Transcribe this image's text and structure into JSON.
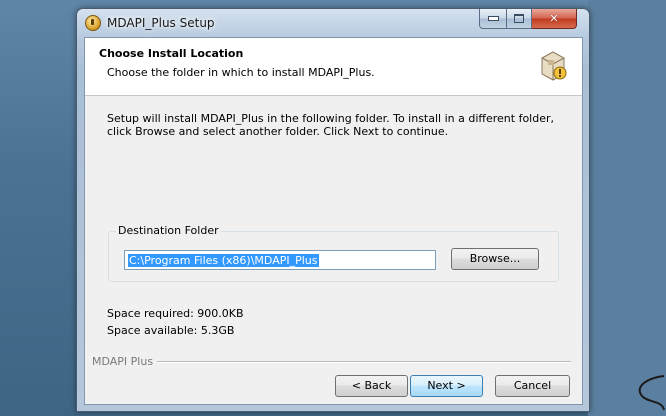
{
  "window": {
    "title": "MDAPI_Plus Setup"
  },
  "header": {
    "title": "Choose Install Location",
    "subtitle": "Choose the folder in which to install MDAPI_Plus."
  },
  "intro_text": "Setup will install MDAPI_Plus in the following folder. To install in a different folder, click Browse and select another folder. Click Next to continue.",
  "destination": {
    "group_label": "Destination Folder",
    "path_value": "C:\\Program Files (x86)\\MDAPI_Plus",
    "browse_label": "Browse..."
  },
  "space": {
    "required": "Space required: 900.0KB",
    "available": "Space available: 5.3GB"
  },
  "footer": {
    "brand": "MDAPI Plus",
    "back_label": "< Back",
    "next_label": "Next >",
    "cancel_label": "Cancel"
  },
  "colors": {
    "selection": "#3399ff",
    "close_button": "#c0391f",
    "desktop": "#4b7293"
  }
}
